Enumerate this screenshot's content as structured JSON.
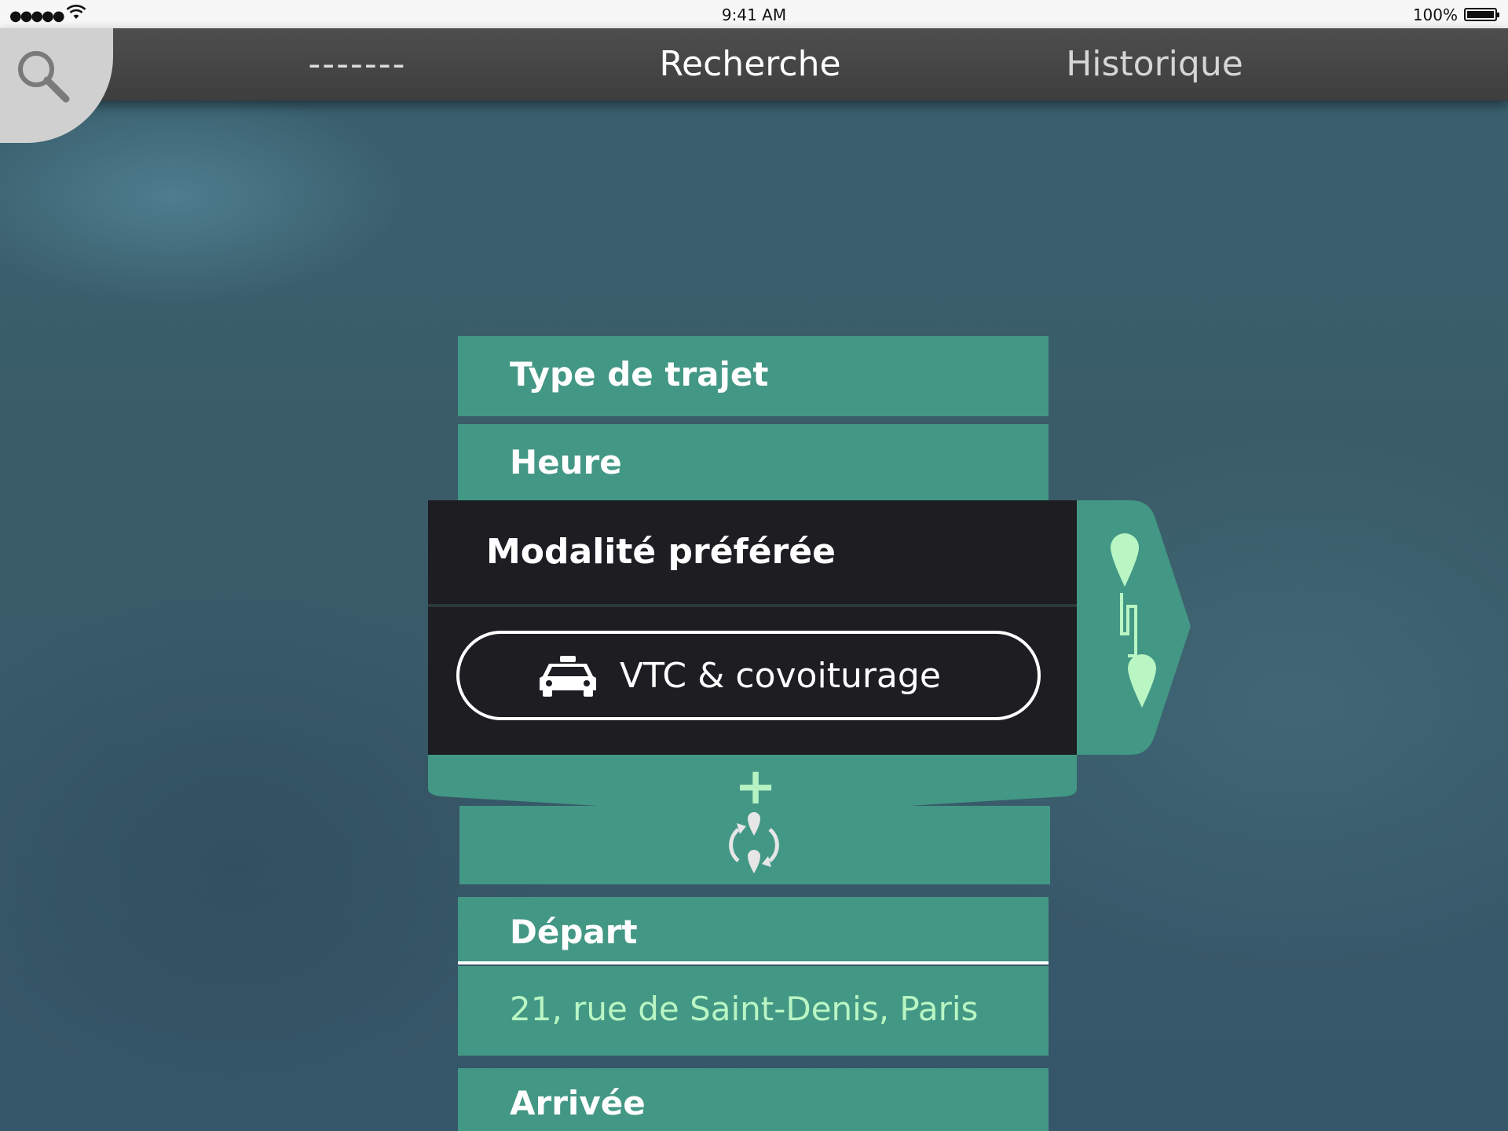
{
  "status_bar": {
    "signal": "●●●●●",
    "time": "9:41 AM",
    "battery": "100%"
  },
  "nav": {
    "tab_other": "-------",
    "tab_search": "Recherche",
    "tab_history": "Historique"
  },
  "form": {
    "trip_type_label": "Type de trajet",
    "time_label": "Heure",
    "mode_title": "Modalité préférée",
    "mode_option": "VTC & covoiturage",
    "departure_label": "Départ",
    "departure_value": "21, rue de Saint-Denis, Paris",
    "arrival_label": "Arrivée"
  },
  "colors": {
    "accent_green": "#439785",
    "light_green": "#b9f6c3",
    "dark_card": "#1d1d22"
  }
}
